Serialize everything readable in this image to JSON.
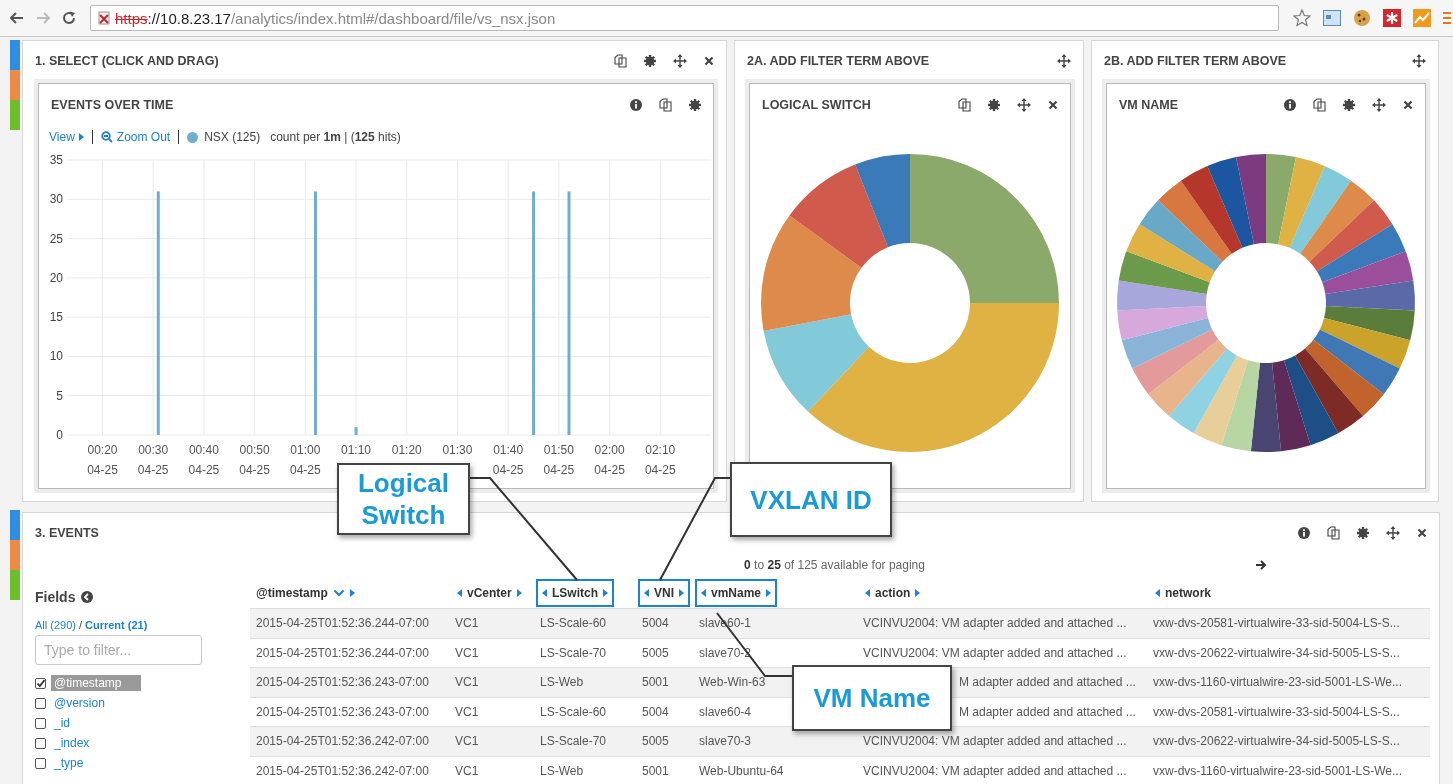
{
  "browser": {
    "scheme": "https",
    "host": "://10.8.23.17",
    "path": "/analytics/index.html#/dashboard/file/vs_nsx.json"
  },
  "panels": [
    {
      "title": "1. SELECT (CLICK AND DRAG)",
      "card": {
        "title": "EVENTS OVER TIME",
        "legend": {
          "view": "View",
          "zoom": "Zoom Out",
          "summary": "count per **1m** | (**125** hits)"
        },
        "chart_data": {
          "type": "bar",
          "grid": true,
          "x": [
            31,
            62,
            70,
            105,
            112
          ],
          "series": [
            {
              "name": "NSX (125)",
              "color": "#6eb0cc",
              "values": [
                31,
                31,
                1,
                31,
                31
              ]
            }
          ],
          "xlim": [
            13,
            140
          ],
          "ylim": [
            0,
            35
          ],
          "yticks": [
            0,
            5,
            10,
            15,
            20,
            25,
            30,
            35
          ],
          "xticks": [
            {
              "value": 20,
              "label": "00:20\n04-25"
            },
            {
              "value": 30,
              "label": "00:30\n04-25"
            },
            {
              "value": 40,
              "label": "00:40\n04-25"
            },
            {
              "value": 50,
              "label": "00:50\n04-25"
            },
            {
              "value": 60,
              "label": "01:00\n04-25"
            },
            {
              "value": 70,
              "label": "01:10"
            },
            {
              "value": 80,
              "label": "01:20"
            },
            {
              "value": 90,
              "label": "01:30"
            },
            {
              "value": 100,
              "label": "01:40\n04-25"
            },
            {
              "value": 110,
              "label": "01:50\n04-25"
            },
            {
              "value": 120,
              "label": "02:00\n04-25"
            },
            {
              "value": 130,
              "label": "02:10\n04-25"
            }
          ]
        }
      }
    },
    {
      "title": "2A. ADD FILTER TERM ABOVE",
      "card": {
        "title": "LOGICAL SWITCH"
      }
    },
    {
      "title": "2B. ADD FILTER TERM ABOVE",
      "card": {
        "title": "VM NAME"
      }
    }
  ],
  "events": {
    "title": "3. EVENTS",
    "paging": "**0** to **25** of 125 available for paging",
    "fields_title": "Fields",
    "all_link": "All (290)",
    "separator": "/",
    "current_link": "Current (21)",
    "filter_placeholder": "Type to filter...",
    "fields": [
      {
        "name": "@timestamp",
        "checked": true
      },
      {
        "name": "@version",
        "checked": false
      },
      {
        "name": "_id",
        "checked": false
      },
      {
        "name": "_index",
        "checked": false
      },
      {
        "name": "_type",
        "checked": false
      }
    ],
    "columns": [
      {
        "label": "@timestamp",
        "kind": "sorted",
        "highlighted": false
      },
      {
        "label": "vCenter",
        "kind": "movable",
        "highlighted": false
      },
      {
        "label": "LSwitch",
        "kind": "movable",
        "highlighted": true
      },
      {
        "label": "VNI",
        "kind": "movable",
        "highlighted": true
      },
      {
        "label": "vmName",
        "kind": "movable",
        "highlighted": true
      },
      {
        "label": "action",
        "kind": "movable",
        "highlighted": false
      },
      {
        "label": "network",
        "kind": "last",
        "highlighted": false
      }
    ],
    "rows": [
      {
        "covered": false,
        "cells": [
          "2015-04-25T01:52:36.244-07:00",
          "VC1",
          "LS-Scale-60",
          "5004",
          "slave60-1",
          "VCINVU2004: VM adapter added and attached ...",
          "vxw-dvs-20581-virtualwire-33-sid-5004-LS-S..."
        ]
      },
      {
        "covered": false,
        "cells": [
          "2015-04-25T01:52:36.244-07:00",
          "VC1",
          "LS-Scale-70",
          "5005",
          "slave70-2",
          "VCINVU2004: VM adapter added and attached ...",
          "vxw-dvs-20622-virtualwire-34-sid-5005-LS-S..."
        ]
      },
      {
        "covered": true,
        "cells": [
          "2015-04-25T01:52:36.243-07:00",
          "VC1",
          "LS-Web",
          "5001",
          "Web-Win-63",
          "M adapter added and attached ...",
          "vxw-dvs-1160-virtualwire-23-sid-5001-LS-We..."
        ]
      },
      {
        "covered": true,
        "cells": [
          "2015-04-25T01:52:36.243-07:00",
          "VC1",
          "LS-Scale-60",
          "5004",
          "slave60-4",
          "M adapter added and attached ...",
          "vxw-dvs-20581-virtualwire-33-sid-5004-LS-S..."
        ]
      },
      {
        "covered": false,
        "cells": [
          "2015-04-25T01:52:36.242-07:00",
          "VC1",
          "LS-Scale-70",
          "5005",
          "slave70-3",
          "VCINVU2004: VM adapter added and attached ...",
          "vxw-dvs-20622-virtualwire-34-sid-5005-LS-S..."
        ]
      },
      {
        "covered": false,
        "cells": [
          "2015-04-25T01:52:36.242-07:00",
          "VC1",
          "LS-Web",
          "5001",
          "Web-Ubuntu-64",
          "VCINVU2004: VM adapter added and attached ...",
          "vxw-dvs-1160-virtualwire-23-sid-5001-LS-We..."
        ]
      }
    ]
  },
  "callouts": [
    {
      "text": "Logical Switch"
    },
    {
      "text": "VXLAN ID"
    },
    {
      "text": "VM Name"
    }
  ]
}
